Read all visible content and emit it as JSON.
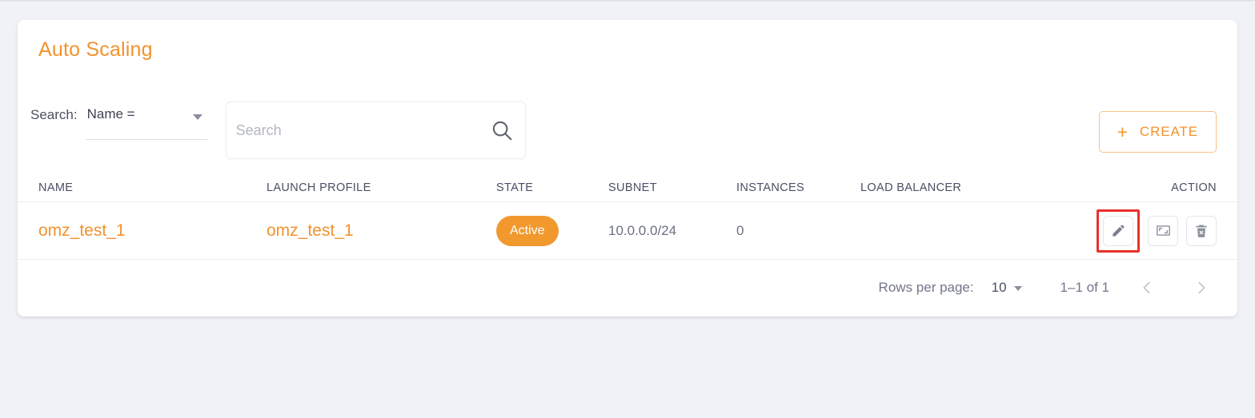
{
  "page": {
    "title": "Auto Scaling",
    "background_color": "#f1f2f7",
    "accent_color": "#f2922d"
  },
  "toolbar": {
    "search_label": "Search:",
    "filter": {
      "selected": "Name =",
      "caret_icon": "chevron-down-icon"
    },
    "search": {
      "value": "",
      "placeholder": "Search",
      "icon": "search-icon"
    },
    "create_button": {
      "label": "CREATE",
      "plus_icon": "plus-icon"
    }
  },
  "table": {
    "headers": {
      "name": "NAME",
      "launch_profile": "LAUNCH PROFILE",
      "state": "STATE",
      "subnet": "SUBNET",
      "instances": "INSTANCES",
      "load_balancer": "LOAD BALANCER",
      "action": "ACTION"
    },
    "rows": [
      {
        "name": "omz_test_1",
        "launch_profile": "omz_test_1",
        "state": "Active",
        "state_color": "#f2992e",
        "subnet": "10.0.0.0/24",
        "instances": "0",
        "load_balancer": "",
        "actions": [
          {
            "name": "edit-button",
            "icon": "pencil-icon",
            "highlighted": true
          },
          {
            "name": "scale-button",
            "icon": "resize-icon",
            "highlighted": false
          },
          {
            "name": "delete-button",
            "icon": "trash-x-icon",
            "highlighted": false
          }
        ]
      }
    ]
  },
  "pagination": {
    "rows_per_page_label": "Rows per page:",
    "rows_per_page_value": "10",
    "range_label": "1–1 of 1",
    "prev_icon": "chevron-left-icon",
    "next_icon": "chevron-right-icon"
  }
}
